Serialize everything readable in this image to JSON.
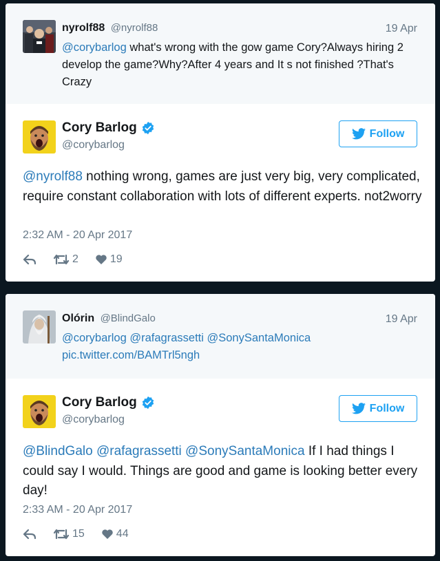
{
  "tweets": [
    {
      "parent": {
        "name": "nyrolf88",
        "handle": "@nyrolf88",
        "date": "19 Apr",
        "mention": "@corybarlog",
        "text": " what's wrong with the gow game Cory?Always hiring 2 develop the game?Why?After 4 years and It s not finished ?That's Crazy",
        "avatar": "stadium-crowd-avatar"
      },
      "reply": {
        "name": "Cory Barlog",
        "handle": "@corybarlog",
        "follow_label": "Follow",
        "mentions": [
          "@nyrolf88"
        ],
        "text": " nothing wrong, games are just very big, very complicated, require constant collaboration with lots of different experts. not2worry",
        "time": "2:32 AM - 20 Apr 2017",
        "retweets": "2",
        "likes": "19"
      }
    },
    {
      "parent": {
        "name": "Olórin",
        "handle": "@BlindGalo",
        "date": "19 Apr",
        "mentions": "@corybarlog @rafagrassetti @SonySantaMonica",
        "link": "pic.twitter.com/BAMTrl5ngh",
        "avatar": "wizard-avatar"
      },
      "reply": {
        "name": "Cory Barlog",
        "handle": "@corybarlog",
        "follow_label": "Follow",
        "mentions": "@BlindGalo @rafagrassetti @SonySantaMonica",
        "text": " If I had things I could say I would. Things are good and game is looking better every day!",
        "time": "2:33 AM - 20 Apr 2017",
        "retweets": "15",
        "likes": "44"
      }
    }
  ],
  "colors": {
    "background": "#0b1720",
    "link": "#2b7bb9",
    "twitter_blue": "#1da1f2",
    "muted": "#657786",
    "parent_bg": "#f5f8fa"
  }
}
